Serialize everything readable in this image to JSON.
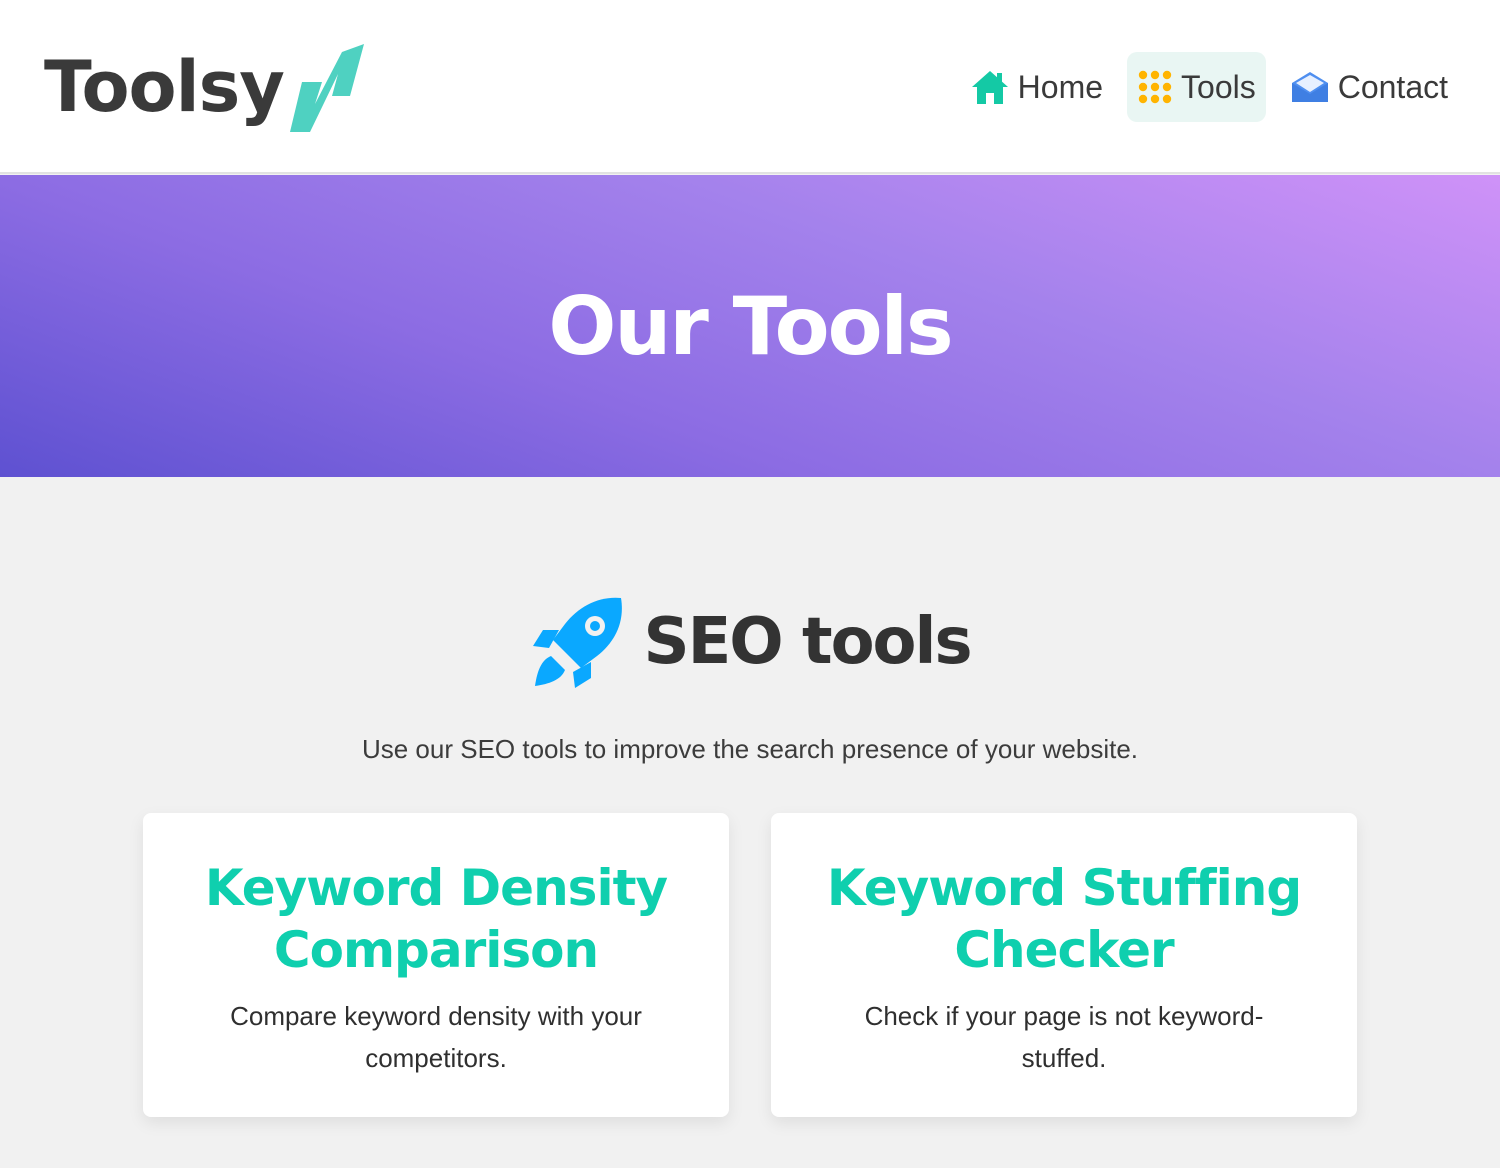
{
  "brand": {
    "name": "Toolsy",
    "accent_color": "#4fd1c1"
  },
  "nav": {
    "items": [
      {
        "label": "Home",
        "icon": "home-icon",
        "active": false
      },
      {
        "label": "Tools",
        "icon": "grid-dots-icon",
        "active": true
      },
      {
        "label": "Contact",
        "icon": "envelope-icon",
        "active": false
      }
    ]
  },
  "hero": {
    "title": "Our Tools"
  },
  "section": {
    "icon": "rocket-icon",
    "title": "SEO tools",
    "description": "Use our SEO tools to improve the search presence of your website."
  },
  "cards": [
    {
      "title": "Keyword Density Comparison",
      "description": "Compare keyword density with your competitors."
    },
    {
      "title": "Keyword Stuffing Checker",
      "description": "Check if your page is not keyword-stuffed."
    }
  ],
  "colors": {
    "card_title": "#0fcfae",
    "hero_gradient_start": "#5e51d1",
    "hero_gradient_end": "#cf92f8",
    "rocket": "#0aa8ff",
    "tools_icon": "#ffb400",
    "home_icon": "#14c9a5",
    "contact_icon": "#4f8ff0"
  }
}
